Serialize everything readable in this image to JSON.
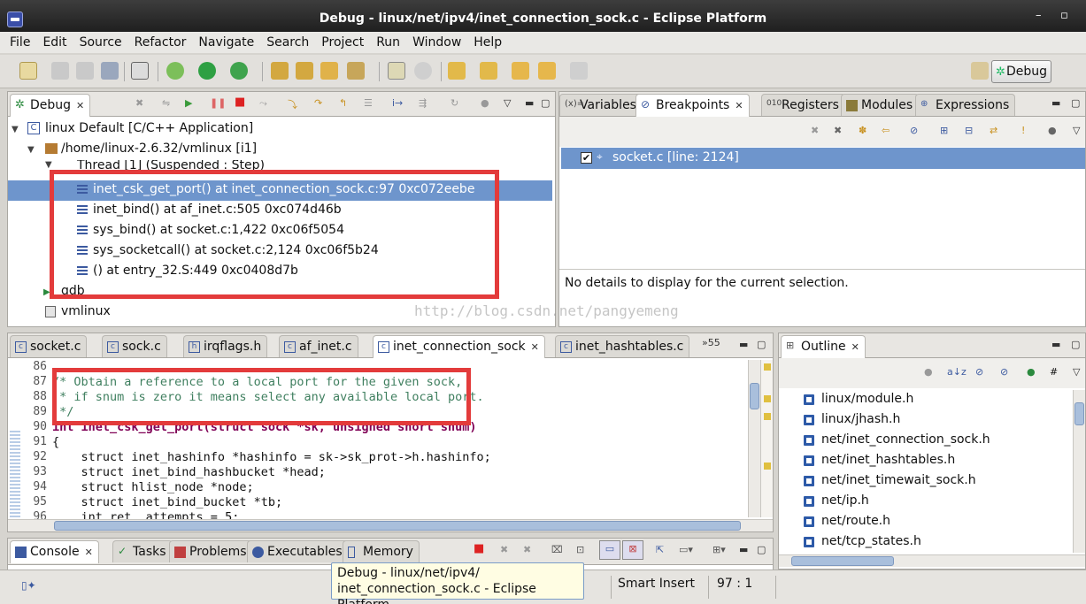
{
  "window": {
    "title": "Debug - linux/net/ipv4/inet_connection_sock.c - Eclipse Platform"
  },
  "menu": [
    "File",
    "Edit",
    "Source",
    "Refactor",
    "Navigate",
    "Search",
    "Project",
    "Run",
    "Window",
    "Help"
  ],
  "perspective": {
    "label": "Debug"
  },
  "debug_view": {
    "tab": "Debug",
    "tree": {
      "launch": "linux Default [C/C++ Application]",
      "process": "/home/linux-2.6.32/vmlinux [i1]",
      "thread": "Thread [1] (Suspended : Step)",
      "frames": [
        "inet_csk_get_port() at inet_connection_sock.c:97 0xc072eebe",
        "inet_bind() at af_inet.c:505 0xc074d46b",
        "sys_bind() at socket.c:1,422 0xc06f5054",
        "sys_socketcall() at socket.c:2,124 0xc06f5b24",
        "() at entry_32.S:449 0xc0408d7b"
      ],
      "gdb": "gdb",
      "vmlinux": "vmlinux"
    }
  },
  "right_view": {
    "tabs": [
      "Variables",
      "Breakpoints",
      "Registers",
      "Modules",
      "Expressions"
    ],
    "breakpoint": "socket.c [line: 2124]",
    "details": "No details to display for the current selection."
  },
  "editor": {
    "tabs": [
      "socket.c",
      "sock.c",
      "irqflags.h",
      "af_inet.c",
      "inet_connection_sock",
      "inet_hashtables.c"
    ],
    "overflow": "»55",
    "lines": [
      {
        "n": "86",
        "text": ""
      },
      {
        "n": "87",
        "text": "/* Obtain a reference to a local port for the given sock,"
      },
      {
        "n": "88",
        "text": " * if snum is zero it means select any available local port."
      },
      {
        "n": "89",
        "text": " */"
      },
      {
        "n": "90",
        "text": "int inet_csk_get_port(struct sock *sk, unsigned short snum)"
      },
      {
        "n": "91",
        "text": "{"
      },
      {
        "n": "92",
        "text": "    struct inet_hashinfo *hashinfo = sk->sk_prot->h.hashinfo;"
      },
      {
        "n": "93",
        "text": "    struct inet_bind_hashbucket *head;"
      },
      {
        "n": "94",
        "text": "    struct hlist_node *node;"
      },
      {
        "n": "95",
        "text": "    struct inet_bind_bucket *tb;"
      },
      {
        "n": "96",
        "text": "    int ret, attempts = 5;"
      }
    ]
  },
  "outline": {
    "tab": "Outline",
    "items": [
      "linux/module.h",
      "linux/jhash.h",
      "net/inet_connection_sock.h",
      "net/inet_hashtables.h",
      "net/inet_timewait_sock.h",
      "net/ip.h",
      "net/route.h",
      "net/tcp_states.h"
    ]
  },
  "console": {
    "tabs": [
      "Console",
      "Tasks",
      "Problems",
      "Executables",
      "Memory"
    ]
  },
  "status": {
    "insert_mode": "Smart Insert",
    "position": "97 : 1"
  },
  "tooltip": {
    "line1": "Debug - linux/net/ipv4/",
    "line2": "inet_connection_sock.c - Eclipse Platform"
  },
  "watermark": "http://blog.csdn.net/pangyemeng",
  "colors": {
    "selection": "#6e95cc",
    "highlight_box": "#e33b3b",
    "comment": "#3f7f5f",
    "keyword": "#7f0055"
  }
}
